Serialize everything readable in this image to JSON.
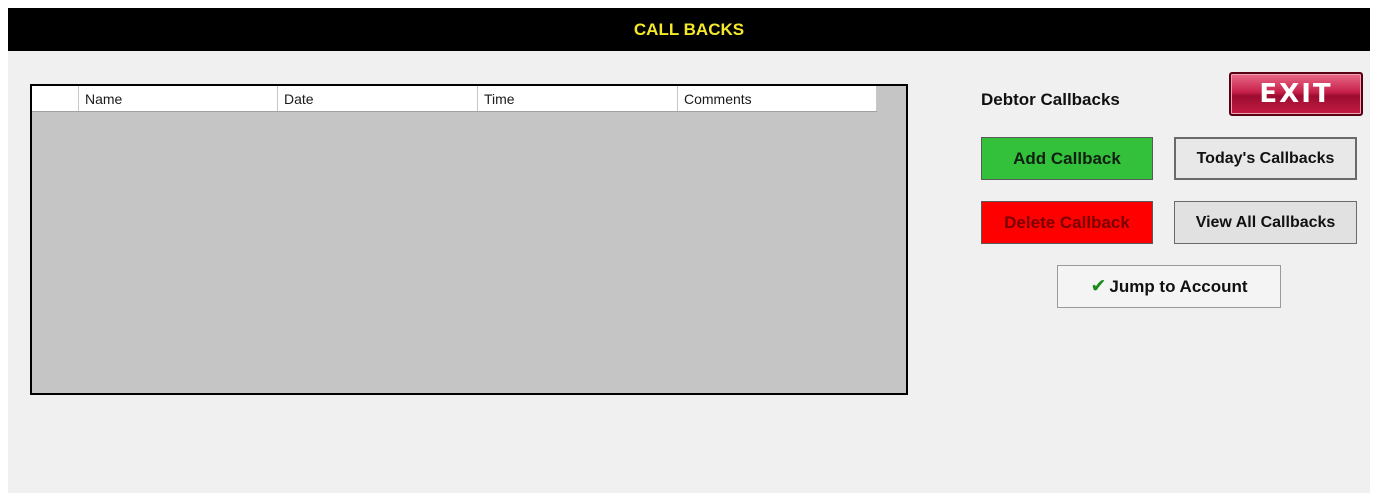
{
  "window": {
    "title": "CALL BACKS"
  },
  "grid": {
    "columns": [
      "Name",
      "Date",
      "Time",
      "Comments"
    ],
    "rows": []
  },
  "panel": {
    "section_label": "Debtor Callbacks",
    "exit_label": "EXIT",
    "add_label": "Add Callback",
    "delete_label": "Delete Callback",
    "today_label": "Today's Callbacks",
    "view_all_label": "View All Callbacks",
    "jump_label": "Jump to Account",
    "jump_icon": "check-icon"
  },
  "colors": {
    "titlebar_bg": "#000000",
    "title_text": "#f5e82a",
    "add_bg": "#33c03a",
    "delete_bg": "#ff0000",
    "exit_bg": "#c8214a",
    "grid_bg": "#c5c5c5"
  }
}
